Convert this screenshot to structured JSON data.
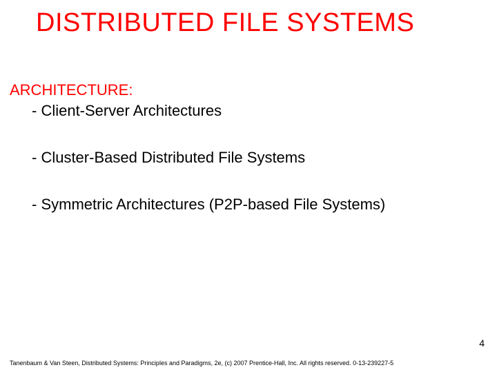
{
  "title": "DISTRIBUTED FILE SYSTEMS",
  "section": "ARCHITECTURE:",
  "bullets": [
    "- Client-Server Architectures",
    "- Cluster-Based Distributed File Systems",
    "- Symmetric Architectures (P2P-based File Systems)"
  ],
  "page_number": "4",
  "footer": "Tanenbaum & Van Steen, Distributed Systems: Principles and Paradigms, 2e, (c) 2007 Prentice-Hall, Inc. All rights reserved. 0-13-239227-5"
}
